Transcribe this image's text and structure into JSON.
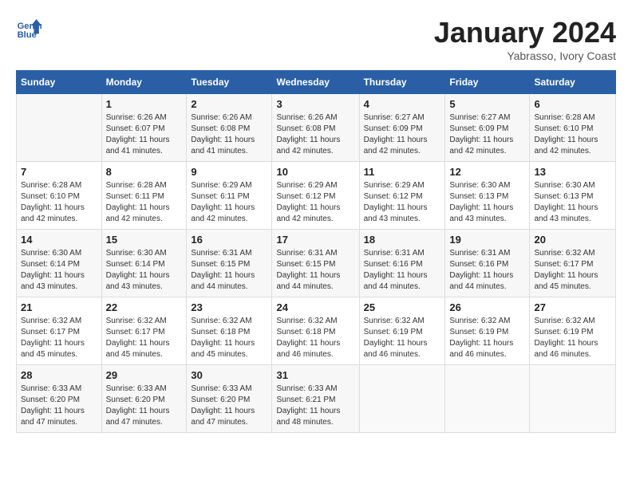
{
  "header": {
    "logo_line1": "General",
    "logo_line2": "Blue",
    "month_title": "January 2024",
    "subtitle": "Yabrasso, Ivory Coast"
  },
  "days_of_week": [
    "Sunday",
    "Monday",
    "Tuesday",
    "Wednesday",
    "Thursday",
    "Friday",
    "Saturday"
  ],
  "weeks": [
    [
      {
        "day": "",
        "sunrise": "",
        "sunset": "",
        "daylight": ""
      },
      {
        "day": "1",
        "sunrise": "Sunrise: 6:26 AM",
        "sunset": "Sunset: 6:07 PM",
        "daylight": "Daylight: 11 hours and 41 minutes."
      },
      {
        "day": "2",
        "sunrise": "Sunrise: 6:26 AM",
        "sunset": "Sunset: 6:08 PM",
        "daylight": "Daylight: 11 hours and 41 minutes."
      },
      {
        "day": "3",
        "sunrise": "Sunrise: 6:26 AM",
        "sunset": "Sunset: 6:08 PM",
        "daylight": "Daylight: 11 hours and 42 minutes."
      },
      {
        "day": "4",
        "sunrise": "Sunrise: 6:27 AM",
        "sunset": "Sunset: 6:09 PM",
        "daylight": "Daylight: 11 hours and 42 minutes."
      },
      {
        "day": "5",
        "sunrise": "Sunrise: 6:27 AM",
        "sunset": "Sunset: 6:09 PM",
        "daylight": "Daylight: 11 hours and 42 minutes."
      },
      {
        "day": "6",
        "sunrise": "Sunrise: 6:28 AM",
        "sunset": "Sunset: 6:10 PM",
        "daylight": "Daylight: 11 hours and 42 minutes."
      }
    ],
    [
      {
        "day": "7",
        "sunrise": "Sunrise: 6:28 AM",
        "sunset": "Sunset: 6:10 PM",
        "daylight": "Daylight: 11 hours and 42 minutes."
      },
      {
        "day": "8",
        "sunrise": "Sunrise: 6:28 AM",
        "sunset": "Sunset: 6:11 PM",
        "daylight": "Daylight: 11 hours and 42 minutes."
      },
      {
        "day": "9",
        "sunrise": "Sunrise: 6:29 AM",
        "sunset": "Sunset: 6:11 PM",
        "daylight": "Daylight: 11 hours and 42 minutes."
      },
      {
        "day": "10",
        "sunrise": "Sunrise: 6:29 AM",
        "sunset": "Sunset: 6:12 PM",
        "daylight": "Daylight: 11 hours and 42 minutes."
      },
      {
        "day": "11",
        "sunrise": "Sunrise: 6:29 AM",
        "sunset": "Sunset: 6:12 PM",
        "daylight": "Daylight: 11 hours and 43 minutes."
      },
      {
        "day": "12",
        "sunrise": "Sunrise: 6:30 AM",
        "sunset": "Sunset: 6:13 PM",
        "daylight": "Daylight: 11 hours and 43 minutes."
      },
      {
        "day": "13",
        "sunrise": "Sunrise: 6:30 AM",
        "sunset": "Sunset: 6:13 PM",
        "daylight": "Daylight: 11 hours and 43 minutes."
      }
    ],
    [
      {
        "day": "14",
        "sunrise": "Sunrise: 6:30 AM",
        "sunset": "Sunset: 6:14 PM",
        "daylight": "Daylight: 11 hours and 43 minutes."
      },
      {
        "day": "15",
        "sunrise": "Sunrise: 6:30 AM",
        "sunset": "Sunset: 6:14 PM",
        "daylight": "Daylight: 11 hours and 43 minutes."
      },
      {
        "day": "16",
        "sunrise": "Sunrise: 6:31 AM",
        "sunset": "Sunset: 6:15 PM",
        "daylight": "Daylight: 11 hours and 44 minutes."
      },
      {
        "day": "17",
        "sunrise": "Sunrise: 6:31 AM",
        "sunset": "Sunset: 6:15 PM",
        "daylight": "Daylight: 11 hours and 44 minutes."
      },
      {
        "day": "18",
        "sunrise": "Sunrise: 6:31 AM",
        "sunset": "Sunset: 6:16 PM",
        "daylight": "Daylight: 11 hours and 44 minutes."
      },
      {
        "day": "19",
        "sunrise": "Sunrise: 6:31 AM",
        "sunset": "Sunset: 6:16 PM",
        "daylight": "Daylight: 11 hours and 44 minutes."
      },
      {
        "day": "20",
        "sunrise": "Sunrise: 6:32 AM",
        "sunset": "Sunset: 6:17 PM",
        "daylight": "Daylight: 11 hours and 45 minutes."
      }
    ],
    [
      {
        "day": "21",
        "sunrise": "Sunrise: 6:32 AM",
        "sunset": "Sunset: 6:17 PM",
        "daylight": "Daylight: 11 hours and 45 minutes."
      },
      {
        "day": "22",
        "sunrise": "Sunrise: 6:32 AM",
        "sunset": "Sunset: 6:17 PM",
        "daylight": "Daylight: 11 hours and 45 minutes."
      },
      {
        "day": "23",
        "sunrise": "Sunrise: 6:32 AM",
        "sunset": "Sunset: 6:18 PM",
        "daylight": "Daylight: 11 hours and 45 minutes."
      },
      {
        "day": "24",
        "sunrise": "Sunrise: 6:32 AM",
        "sunset": "Sunset: 6:18 PM",
        "daylight": "Daylight: 11 hours and 46 minutes."
      },
      {
        "day": "25",
        "sunrise": "Sunrise: 6:32 AM",
        "sunset": "Sunset: 6:19 PM",
        "daylight": "Daylight: 11 hours and 46 minutes."
      },
      {
        "day": "26",
        "sunrise": "Sunrise: 6:32 AM",
        "sunset": "Sunset: 6:19 PM",
        "daylight": "Daylight: 11 hours and 46 minutes."
      },
      {
        "day": "27",
        "sunrise": "Sunrise: 6:32 AM",
        "sunset": "Sunset: 6:19 PM",
        "daylight": "Daylight: 11 hours and 46 minutes."
      }
    ],
    [
      {
        "day": "28",
        "sunrise": "Sunrise: 6:33 AM",
        "sunset": "Sunset: 6:20 PM",
        "daylight": "Daylight: 11 hours and 47 minutes."
      },
      {
        "day": "29",
        "sunrise": "Sunrise: 6:33 AM",
        "sunset": "Sunset: 6:20 PM",
        "daylight": "Daylight: 11 hours and 47 minutes."
      },
      {
        "day": "30",
        "sunrise": "Sunrise: 6:33 AM",
        "sunset": "Sunset: 6:20 PM",
        "daylight": "Daylight: 11 hours and 47 minutes."
      },
      {
        "day": "31",
        "sunrise": "Sunrise: 6:33 AM",
        "sunset": "Sunset: 6:21 PM",
        "daylight": "Daylight: 11 hours and 48 minutes."
      },
      {
        "day": "",
        "sunrise": "",
        "sunset": "",
        "daylight": ""
      },
      {
        "day": "",
        "sunrise": "",
        "sunset": "",
        "daylight": ""
      },
      {
        "day": "",
        "sunrise": "",
        "sunset": "",
        "daylight": ""
      }
    ]
  ]
}
